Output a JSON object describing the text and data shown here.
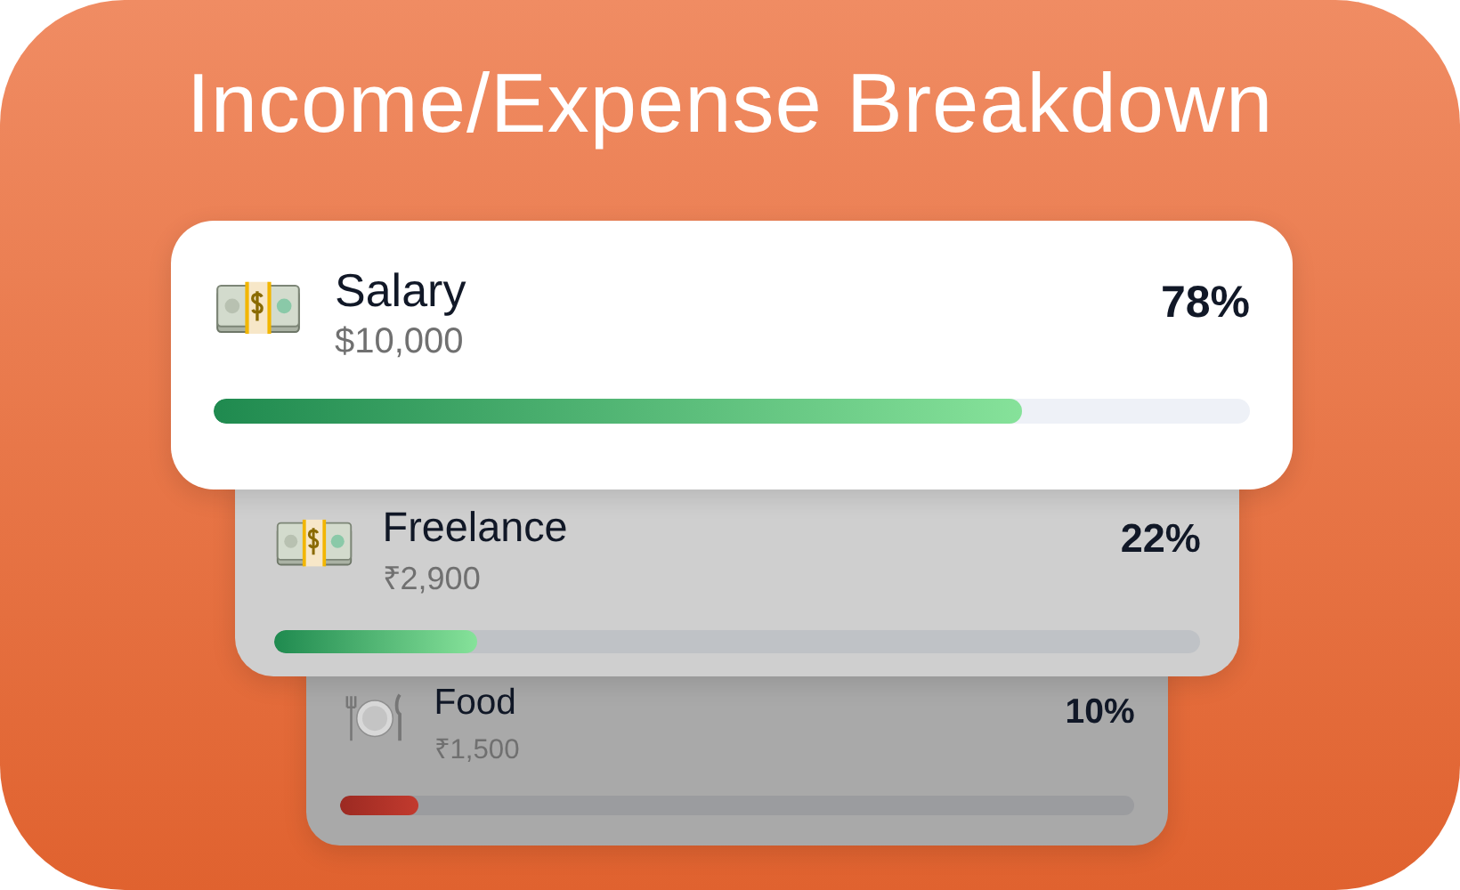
{
  "title": "Income/Expense Breakdown",
  "items": [
    {
      "kind": "income",
      "name": "Salary",
      "amount": "$10,000",
      "percent": "78%",
      "level": 0.78
    },
    {
      "kind": "income",
      "name": "Freelance",
      "amount": "₹2,900",
      "percent": "22%",
      "level": 0.22
    },
    {
      "kind": "expense",
      "name": "Food",
      "amount": "₹1,500",
      "percent": "10%",
      "level": 0.1
    }
  ]
}
